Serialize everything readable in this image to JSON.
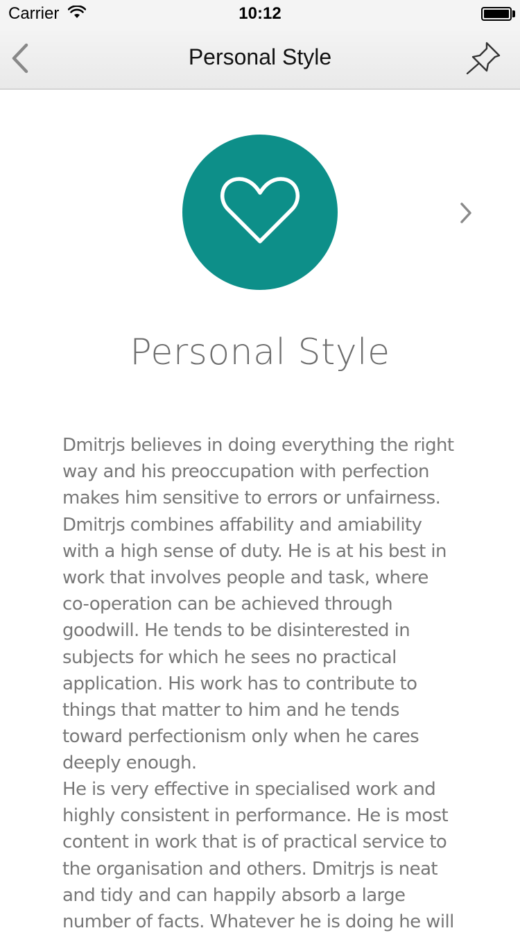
{
  "status_bar": {
    "carrier": "Carrier",
    "time": "10:12"
  },
  "nav": {
    "title": "Personal Style",
    "back_icon": "chevron-left-icon",
    "pin_icon": "pin-icon"
  },
  "hero": {
    "icon": "heart-icon",
    "circle_color": "#0d8f89",
    "next_icon": "chevron-right-icon"
  },
  "content": {
    "title": "Personal Style",
    "paragraphs": [
      "Dmitrjs believes in doing everything the right way and his preoccupation with perfection makes him sensitive to errors or unfairness. Dmitrjs combines affability and amiability with a high sense of duty. He is at his best in work that involves people and task, where co-operation can be achieved through goodwill. He tends to be disinterested in subjects for which he sees no practical application. His work has to contribute to things that matter to him and he tends toward perfectionism only when he cares deeply enough.",
      "He is very effective in specialised work and highly consistent in performance. He is most content in work that is of practical service to the organisation and others. Dmitrjs is neat and tidy and can happily absorb a large number of facts. Whatever he is doing he will"
    ]
  }
}
